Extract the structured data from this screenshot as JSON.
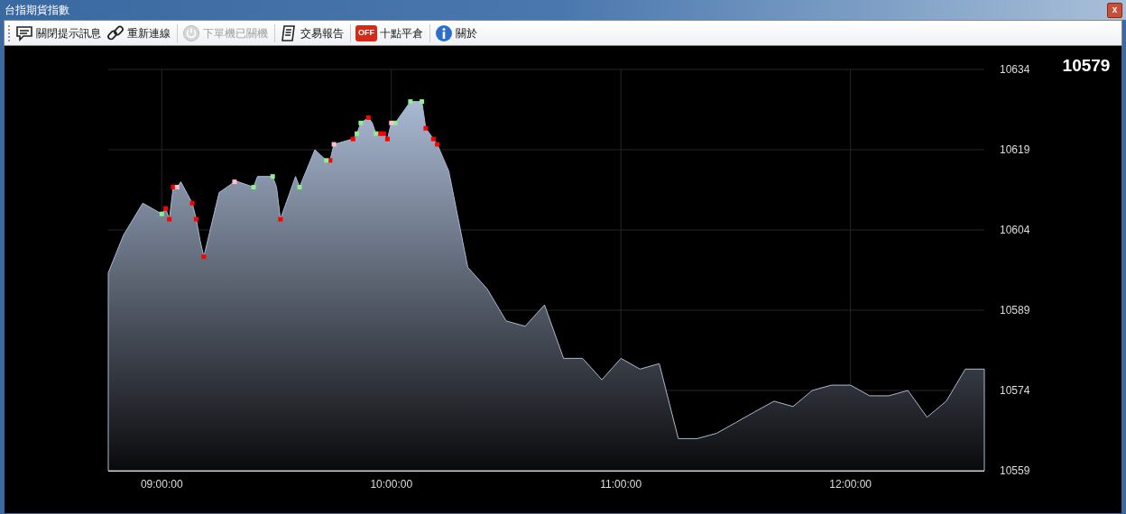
{
  "window": {
    "title": "台指期貨指數",
    "close_label": "x"
  },
  "toolbar": [
    {
      "kind": "message",
      "label": "關閉提示訊息",
      "disabled": false
    },
    {
      "kind": "link",
      "label": "重新連線",
      "disabled": false
    },
    {
      "kind": "power",
      "label": "下單機已關機",
      "disabled": true
    },
    {
      "kind": "report",
      "label": "交易報告",
      "disabled": false
    },
    {
      "kind": "off",
      "label": "十點平倉",
      "disabled": false,
      "icon_text": "OFF"
    },
    {
      "kind": "info",
      "label": "關於",
      "disabled": false
    }
  ],
  "current_price": "10579",
  "chart_data": {
    "type": "area",
    "x": [
      8.767,
      8.833,
      8.917,
      9,
      9.017,
      9.033,
      9.05,
      9.067,
      9.083,
      9.133,
      9.15,
      9.167,
      9.183,
      9.25,
      9.317,
      9.333,
      9.4,
      9.417,
      9.483,
      9.5,
      9.517,
      9.583,
      9.6,
      9.667,
      9.717,
      9.733,
      9.75,
      9.833,
      9.85,
      9.867,
      9.9,
      9.917,
      9.933,
      9.95,
      9.967,
      9.983,
      10,
      10.017,
      10.083,
      10.133,
      10.15,
      10.167,
      10.183,
      10.2,
      10.25,
      10.333,
      10.417,
      10.5,
      10.583,
      10.667,
      10.75,
      10.833,
      10.917,
      11,
      11.083,
      11.167,
      11.25,
      11.333,
      11.417,
      11.5,
      11.583,
      11.667,
      11.75,
      11.833,
      11.917,
      12,
      12.083,
      12.167,
      12.25,
      12.333,
      12.417,
      12.5,
      12.583
    ],
    "series": [
      {
        "color": "#a9b9d3",
        "values": [
          10596,
          10603,
          10609,
          10607,
          10608,
          10606,
          10612,
          10612,
          10613,
          10609,
          10606,
          10602,
          10599,
          10611,
          10613,
          10613,
          10612,
          10614,
          10614,
          10612,
          10606,
          10614,
          10612,
          10619,
          10617,
          10617,
          10620,
          10621,
          10622,
          10624,
          10625,
          10624,
          10622,
          10622,
          10622,
          10621,
          10624,
          10624,
          10628,
          10628,
          10623,
          10622,
          10621,
          10620,
          10615,
          10597,
          10593,
          10587,
          10586,
          10590,
          10580,
          10580,
          10576,
          10580,
          10578,
          10579,
          10565,
          10565,
          10566,
          10568,
          10570,
          10572,
          10571,
          10574,
          10575,
          10575,
          10573,
          10573,
          10574,
          10569,
          10572,
          10578,
          10578
        ]
      },
      {
        "type": "scatter",
        "color": "#ff0000",
        "values": [
          null,
          null,
          null,
          null,
          10608,
          10606,
          10612,
          null,
          null,
          10609,
          10606,
          null,
          10599,
          null,
          null,
          null,
          null,
          null,
          null,
          null,
          10606,
          null,
          null,
          null,
          null,
          10617,
          null,
          10621,
          null,
          null,
          10625,
          null,
          null,
          10622,
          10622,
          10621,
          null,
          null,
          null,
          null,
          10623,
          null,
          10621,
          10620,
          null,
          null,
          null,
          null,
          null,
          null,
          null,
          null,
          null,
          null,
          null,
          null,
          null,
          null,
          null,
          null,
          null,
          null,
          null,
          null,
          null,
          null,
          null,
          null,
          null,
          null,
          null,
          null,
          null
        ]
      },
      {
        "type": "scatter",
        "color": "#90ee90",
        "values": [
          null,
          null,
          null,
          10607,
          null,
          null,
          null,
          null,
          null,
          null,
          null,
          null,
          null,
          null,
          null,
          null,
          10612,
          null,
          10614,
          null,
          null,
          null,
          10612,
          null,
          10617,
          null,
          null,
          null,
          10622,
          10624,
          null,
          null,
          10622,
          null,
          null,
          null,
          null,
          10624,
          10628,
          10628,
          null,
          null,
          null,
          null,
          null,
          null,
          null,
          null,
          null,
          null,
          null,
          null,
          null,
          null,
          null,
          null,
          null,
          null,
          null,
          null,
          null,
          null,
          null,
          null,
          null,
          null,
          null,
          null,
          null,
          null,
          null,
          null,
          null
        ]
      },
      {
        "type": "scatter",
        "color": "#ffc0cb",
        "values": [
          null,
          null,
          null,
          null,
          null,
          null,
          null,
          10612,
          null,
          null,
          null,
          null,
          null,
          null,
          10613,
          null,
          null,
          null,
          null,
          null,
          null,
          null,
          null,
          null,
          null,
          null,
          10620,
          null,
          null,
          null,
          null,
          null,
          null,
          null,
          null,
          null,
          10624,
          null,
          null,
          null,
          null,
          null,
          null,
          null,
          null,
          null,
          null,
          null,
          null,
          null,
          null,
          null,
          null,
          null,
          null,
          null,
          null,
          null,
          null,
          null,
          null,
          null,
          null,
          null,
          null,
          null,
          null,
          null,
          null,
          null,
          null,
          null,
          null
        ]
      }
    ],
    "grid": true,
    "xlim": [
      8.767,
      12.583
    ],
    "ylim": [
      10559,
      10634
    ],
    "xticks": [
      {
        "value": 9,
        "label": "09:00:00"
      },
      {
        "value": 10,
        "label": "10:00:00"
      },
      {
        "value": 11,
        "label": "11:00:00"
      },
      {
        "value": 12,
        "label": "12:00:00"
      }
    ],
    "yticks": [
      10559,
      10574,
      10589,
      10604,
      10619,
      10634
    ]
  }
}
